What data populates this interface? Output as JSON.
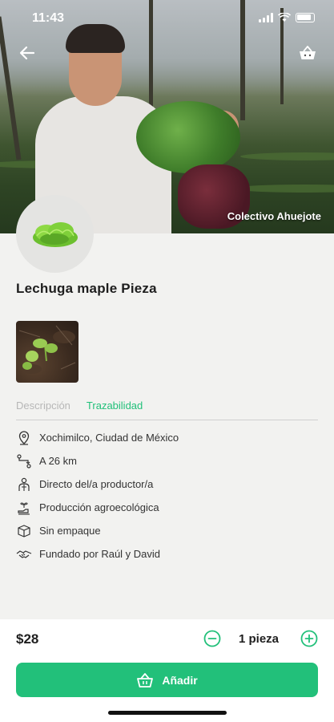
{
  "status_bar": {
    "time": "11:43"
  },
  "hero": {
    "producer_name": "Colectivo Ahuejote"
  },
  "product": {
    "title": "Lechuga maple Pieza"
  },
  "tabs": [
    {
      "label": "Descripción",
      "active": false
    },
    {
      "label": "Trazabilidad",
      "active": true
    }
  ],
  "traceability": [
    {
      "icon": "location-pin-icon",
      "text": "Xochimilco, Ciudad de México"
    },
    {
      "icon": "route-icon",
      "text": "A 26 km"
    },
    {
      "icon": "producer-icon",
      "text": "Directo del/a productor/a"
    },
    {
      "icon": "plant-hand-icon",
      "text": "Producción agroecológica"
    },
    {
      "icon": "box-icon",
      "text": "Sin empaque"
    },
    {
      "icon": "handshake-icon",
      "text": "Fundado por Raúl y David"
    }
  ],
  "purchase": {
    "price": "$28",
    "quantity": "1 pieza",
    "add_label": "Añadir"
  },
  "colors": {
    "accent": "#22c07a",
    "background": "#f2f2f0"
  }
}
